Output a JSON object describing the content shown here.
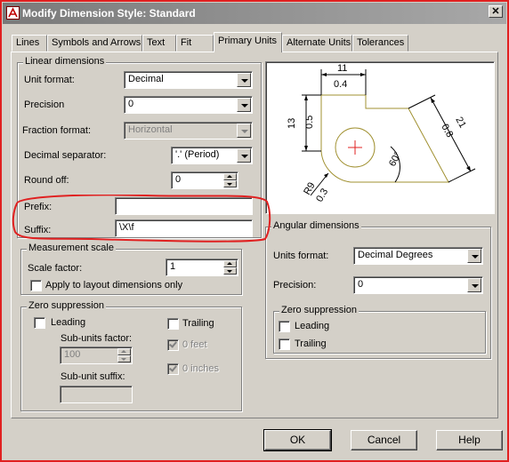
{
  "window": {
    "title": "Modify Dimension Style: Standard",
    "close_glyph": "✕"
  },
  "tabs": [
    {
      "label": "Lines",
      "active": false
    },
    {
      "label": "Symbols and Arrows",
      "active": false
    },
    {
      "label": "Text",
      "active": false
    },
    {
      "label": "Fit",
      "active": false
    },
    {
      "label": "Primary Units",
      "active": true
    },
    {
      "label": "Alternate Units",
      "active": false
    },
    {
      "label": "Tolerances",
      "active": false
    }
  ],
  "linear": {
    "group_title": "Linear dimensions",
    "unit_format_label": "Unit format:",
    "unit_format_value": "Decimal",
    "precision_label": "Precision",
    "precision_value": "0",
    "fraction_format_label": "Fraction format:",
    "fraction_format_value": "Horizontal",
    "decimal_separator_label": "Decimal separator:",
    "decimal_separator_value": "'.' (Period)",
    "round_off_label": "Round off:",
    "round_off_value": "0",
    "prefix_label": "Prefix:",
    "prefix_value": "",
    "suffix_label": "Suffix:",
    "suffix_value": "\\X\\f"
  },
  "measurement": {
    "group_title": "Measurement scale",
    "scale_factor_label": "Scale factor:",
    "scale_factor_value": "1",
    "apply_layout_label": "Apply to layout dimensions only",
    "apply_layout_checked": false
  },
  "zero_suppression": {
    "group_title": "Zero suppression",
    "leading_label": "Leading",
    "trailing_label": "Trailing",
    "sub_units_factor_label": "Sub-units factor:",
    "sub_units_factor_value": "100",
    "feet_label": "0 feet",
    "inches_label": "0 inches",
    "sub_unit_suffix_label": "Sub-unit suffix:",
    "sub_unit_suffix_value": ""
  },
  "angular": {
    "group_title": "Angular dimensions",
    "units_format_label": "Units format:",
    "units_format_value": "Decimal Degrees",
    "precision_label": "Precision:",
    "precision_value": "0",
    "zero_group_title": "Zero suppression",
    "leading_label": "Leading",
    "trailing_label": "Trailing"
  },
  "preview": {
    "dim_top_1": "11",
    "dim_top_2": "0.4",
    "dim_left_1": "13",
    "dim_left_2": "0.5",
    "dim_right_1": "21",
    "dim_right_2": "0.8",
    "dim_angle": "60°",
    "dim_radius_1": "R9",
    "dim_radius_2": "0.3",
    "line_color": "#a09030",
    "dim_color": "#000000",
    "center_color": "#e02020"
  },
  "buttons": {
    "ok": "OK",
    "cancel": "Cancel",
    "help": "Help"
  },
  "colors": {
    "annotation_red": "#e02020",
    "dialog_face": "#d4d0c8"
  }
}
